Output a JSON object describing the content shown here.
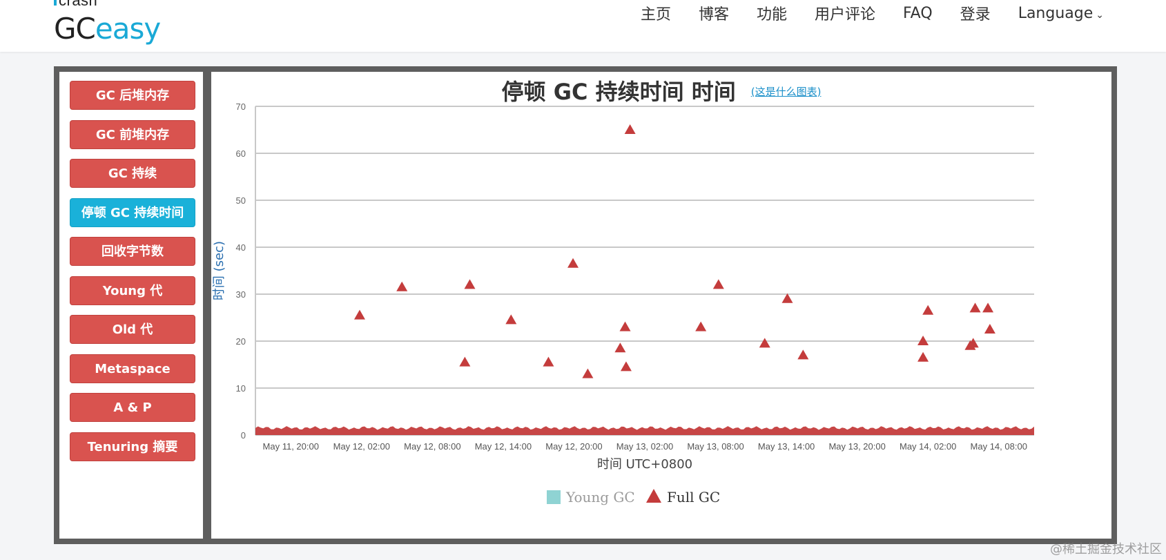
{
  "header": {
    "logo_top": "crash",
    "logo_gc": "GC",
    "logo_easy": "easy",
    "nav": [
      "主页",
      "博客",
      "功能",
      "用户评论",
      "FAQ",
      "登录"
    ],
    "language": "Language"
  },
  "sidebar": {
    "items": [
      {
        "label": "GC 后堆内存",
        "active": false
      },
      {
        "label": "GC 前堆内存",
        "active": false
      },
      {
        "label": "GC 持续",
        "active": false
      },
      {
        "label": "停顿 GC 持续时间",
        "active": true
      },
      {
        "label": "回收字节数",
        "active": false
      },
      {
        "label": "Young 代",
        "active": false
      },
      {
        "label": "Old 代",
        "active": false
      },
      {
        "label": "Metaspace",
        "active": false
      },
      {
        "label": "A & P",
        "active": false
      },
      {
        "label": "Tenuring 摘要",
        "active": false
      }
    ]
  },
  "chart": {
    "help_link": "(这是什么图表)"
  },
  "watermark": "@稀土掘金技术社区",
  "colors": {
    "accent": "#1ab1d9",
    "button": "#d9534f",
    "young_gc": "#8fd3d3",
    "full_gc": "#c43c3c"
  },
  "chart_data": {
    "type": "scatter",
    "title": "停顿 GC 持续时间 时间",
    "xlabel": "时间 UTC+0800",
    "ylabel": "时间 (sec)",
    "ylim": [
      0,
      70
    ],
    "yticks": [
      0,
      10,
      20,
      30,
      40,
      50,
      60,
      70
    ],
    "xlim": [
      "May 11, 17:00",
      "May 14, 11:00"
    ],
    "xticks": [
      {
        "t": "2024-05-11T20:00",
        "label": "May 11, 20:00"
      },
      {
        "t": "2024-05-12T02:00",
        "label": "May 12, 02:00"
      },
      {
        "t": "2024-05-12T08:00",
        "label": "May 12, 08:00"
      },
      {
        "t": "2024-05-12T14:00",
        "label": "May 12, 14:00"
      },
      {
        "t": "2024-05-12T20:00",
        "label": "May 12, 20:00"
      },
      {
        "t": "2024-05-13T02:00",
        "label": "May 13, 02:00"
      },
      {
        "t": "2024-05-13T08:00",
        "label": "May 13, 08:00"
      },
      {
        "t": "2024-05-13T14:00",
        "label": "May 13, 14:00"
      },
      {
        "t": "2024-05-13T20:00",
        "label": "May 13, 20:00"
      },
      {
        "t": "2024-05-14T02:00",
        "label": "May 14, 02:00"
      },
      {
        "t": "2024-05-14T08:00",
        "label": "May 14, 08:00"
      }
    ],
    "grid": true,
    "legend": "bottom-center",
    "series": [
      {
        "name": "Young GC",
        "marker": "square",
        "color": "#8fd3d3",
        "values": []
      },
      {
        "name": "Full GC",
        "marker": "triangle",
        "color": "#c43c3c",
        "values": [
          {
            "x": "2024-05-12T01:50",
            "y": 25.5
          },
          {
            "x": "2024-05-12T05:25",
            "y": 31.5
          },
          {
            "x": "2024-05-12T10:45",
            "y": 15.5
          },
          {
            "x": "2024-05-12T11:10",
            "y": 32.0
          },
          {
            "x": "2024-05-12T14:40",
            "y": 24.5
          },
          {
            "x": "2024-05-12T17:50",
            "y": 15.5
          },
          {
            "x": "2024-05-12T19:55",
            "y": 36.5
          },
          {
            "x": "2024-05-12T21:10",
            "y": 13.0
          },
          {
            "x": "2024-05-12T23:55",
            "y": 18.5
          },
          {
            "x": "2024-05-13T00:20",
            "y": 23.0
          },
          {
            "x": "2024-05-13T00:25",
            "y": 14.5
          },
          {
            "x": "2024-05-13T00:45",
            "y": 65.0
          },
          {
            "x": "2024-05-13T06:45",
            "y": 23.0
          },
          {
            "x": "2024-05-13T08:15",
            "y": 32.0
          },
          {
            "x": "2024-05-13T12:10",
            "y": 19.5
          },
          {
            "x": "04-05-13T14:05",
            "y": 29.0
          },
          {
            "x": "2024-05-13T15:25",
            "y": 17.0
          },
          {
            "x": "2024-05-14T01:35",
            "y": 20.0
          },
          {
            "x": "2024-05-14T01:35",
            "y": 16.5
          },
          {
            "x": "2024-05-14T02:00",
            "y": 26.5
          },
          {
            "x": "2024-05-14T05:35",
            "y": 19.0
          },
          {
            "x": "2024-05-14T05:50",
            "y": 19.5
          },
          {
            "x": "2024-05-14T06:00",
            "y": 27.0
          },
          {
            "x": "2024-05-14T07:05",
            "y": 27.0
          },
          {
            "x": "2024-05-14T07:15",
            "y": 22.5
          }
        ]
      }
    ]
  }
}
